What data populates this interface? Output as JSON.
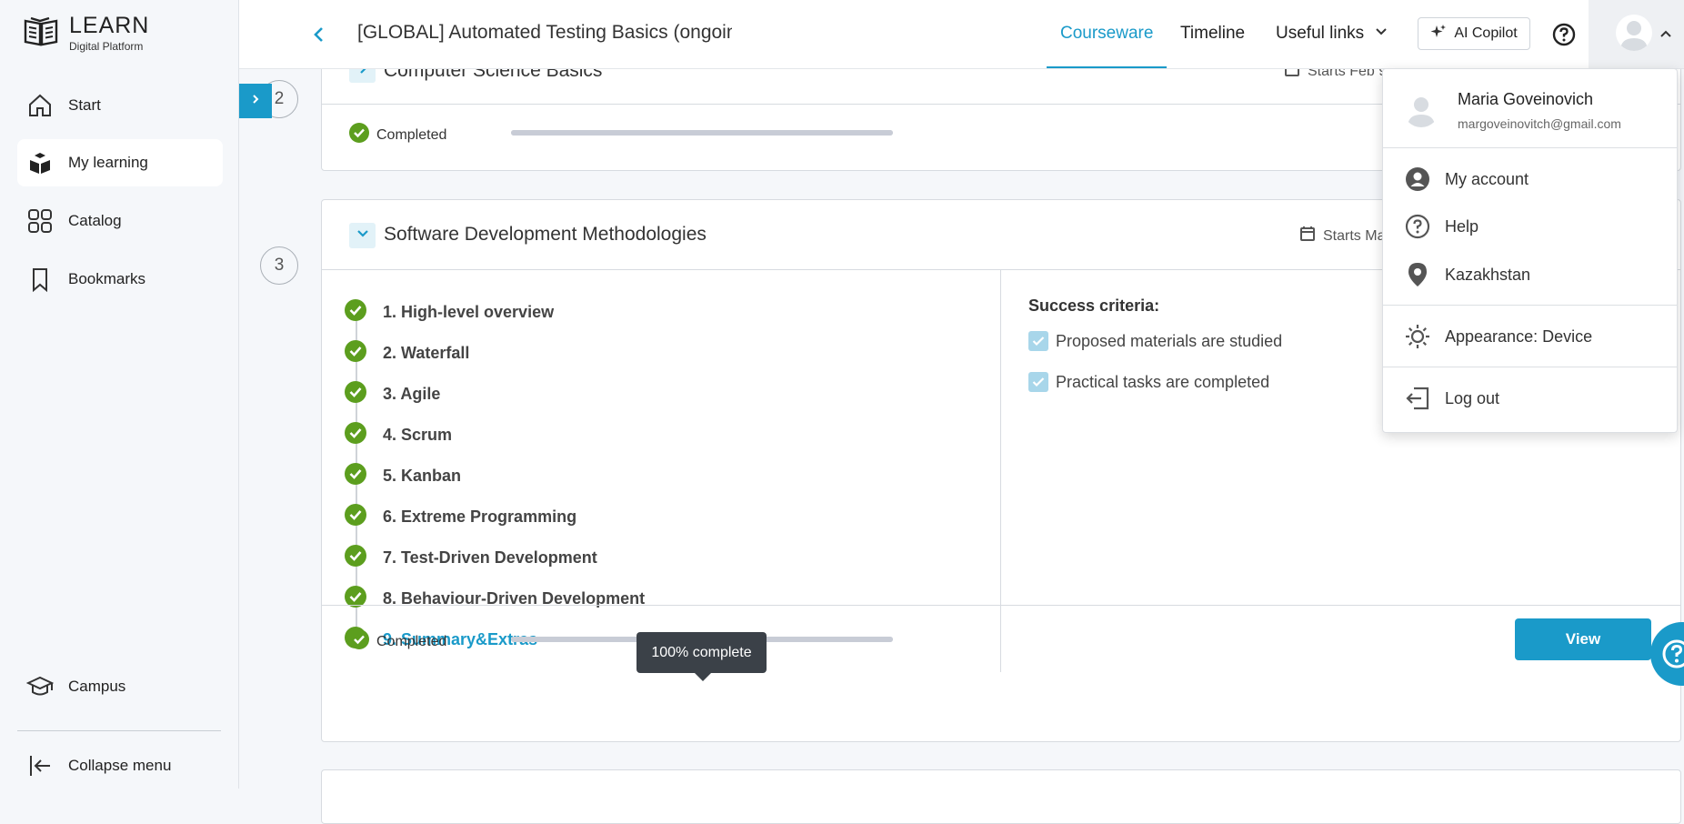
{
  "app": {
    "logo_title": "LEARN",
    "logo_subtitle": "Digital Platform"
  },
  "sidebar": {
    "items": [
      {
        "label": "Start",
        "icon": "home-icon"
      },
      {
        "label": "My learning",
        "icon": "learning-icon",
        "active": true
      },
      {
        "label": "Catalog",
        "icon": "grid-icon"
      },
      {
        "label": "Bookmarks",
        "icon": "bookmark-icon"
      }
    ],
    "bottom": [
      {
        "label": "Campus",
        "icon": "graduation-cap-icon"
      },
      {
        "label": "Collapse menu",
        "icon": "collapse-icon"
      }
    ]
  },
  "header": {
    "course_title": "[GLOBAL] Automated Testing Basics (ongoin",
    "tabs": [
      {
        "label": "Courseware",
        "active": true
      },
      {
        "label": "Timeline"
      },
      {
        "label": "Useful links"
      }
    ],
    "copilot_label": "AI Copilot"
  },
  "sections": [
    {
      "step": "2",
      "title": "Computer Science Basics",
      "starts": "Starts Feb 9",
      "status": "Completed",
      "progress": 1.0
    },
    {
      "step": "3",
      "title": "Software Development Methodologies",
      "starts": "Starts Ma",
      "status": "Completed",
      "progress": 1.0,
      "lessons": [
        "1. High-level overview",
        "2. Waterfall",
        "3. Agile",
        "4. Scrum",
        "5. Kanban",
        "6. Extreme Programming",
        "7. Test-Driven Development",
        "8. Behaviour-Driven Development",
        "9. Summary&Extras"
      ],
      "criteria_title": "Success criteria:",
      "criteria": [
        "Proposed materials are studied",
        "Practical tasks are completed"
      ],
      "view_label": "View",
      "tooltip": "100% complete"
    }
  ],
  "user_menu": {
    "name": "Maria Goveinovich",
    "email": "margoveinovitch@gmail.com",
    "items": [
      {
        "label": "My account",
        "icon": "account-icon"
      },
      {
        "label": "Help",
        "icon": "help-icon"
      },
      {
        "label": "Kazakhstan",
        "icon": "location-pin-icon"
      },
      {
        "label": "Appearance: Device",
        "icon": "sun-icon"
      },
      {
        "label": "Log out",
        "icon": "logout-icon"
      }
    ]
  },
  "colors": {
    "accent": "#1a9ac9",
    "success": "#5c9e1e"
  }
}
